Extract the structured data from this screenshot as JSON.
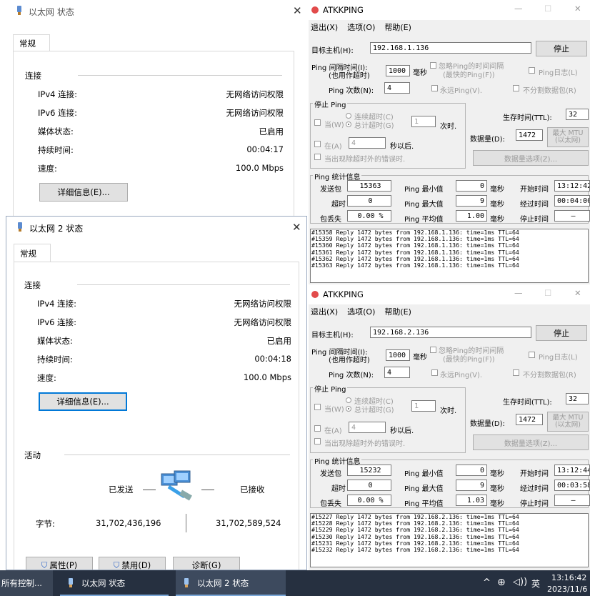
{
  "status1": {
    "title": "以太网 状态",
    "tab": "常规",
    "section": "连接",
    "rows": [
      {
        "label": "IPv4 连接:",
        "value": "无网络访问权限"
      },
      {
        "label": "IPv6 连接:",
        "value": "无网络访问权限"
      },
      {
        "label": "媒体状态:",
        "value": "已启用"
      },
      {
        "label": "持续时间:",
        "value": "00:04:17"
      },
      {
        "label": "速度:",
        "value": "100.0 Mbps"
      }
    ],
    "details_button": "详细信息(E)..."
  },
  "status2": {
    "title": "以太网 2 状态",
    "tab": "常规",
    "section": "连接",
    "rows": [
      {
        "label": "IPv4 连接:",
        "value": "无网络访问权限"
      },
      {
        "label": "IPv6 连接:",
        "value": "无网络访问权限"
      },
      {
        "label": "媒体状态:",
        "value": "已启用"
      },
      {
        "label": "持续时间:",
        "value": "00:04:18"
      },
      {
        "label": "速度:",
        "value": "100.0 Mbps"
      }
    ],
    "details_button": "详细信息(E)...",
    "activity": "活动",
    "sent_label": "已发送",
    "recv_label": "已接收",
    "bytes_label": "字节:",
    "bytes_sent": "31,702,436,196",
    "bytes_recv": "31,702,589,524",
    "buttons": [
      "属性(P)",
      "禁用(D)",
      "诊断(G)"
    ]
  },
  "atk_common": {
    "title": "ATKKPING",
    "menu": [
      "退出(X)",
      "选项(O)",
      "帮助(E)"
    ],
    "target_label": "目标主机(H):",
    "stop_button": "停止",
    "interval_label1": "Ping 间隔时间(I):",
    "interval_label2": "(也用作超时)",
    "interval_value": "1000",
    "ms_label": "毫秒",
    "ignore1": "忽略Ping的时间间隔",
    "ignore2": "(最快的Ping(F))",
    "pinglog": "Ping日志(L)",
    "count_label": "Ping 次数(N):",
    "count_value": "4",
    "forever": "永远Ping(V).",
    "nofrag": "不分割数据包(R)",
    "stop_group": "停止 Ping",
    "when": "当(W)",
    "consec": "连续超时(C)",
    "total": "总计超时(G)",
    "timeout_value": "1",
    "times": "次时.",
    "ttl_label": "生存时间(TTL):",
    "ttl_value": "32",
    "at_label": "在(A)",
    "at_value": "4",
    "sec_after": "秒以后.",
    "data_label": "数据量(D):",
    "data_value": "1472",
    "mtu1": "最大 MTU",
    "mtu2": "(以太网)",
    "on_error": "当出现除超时外的错误时.",
    "data_opts": "数据量选项(Z)...",
    "stats_group": "Ping 统计信息",
    "sent_label": "发送包",
    "timeout_label": "超时",
    "loss_label": "包丢失",
    "min_label": "Ping 最小值",
    "max_label": "Ping 最大值",
    "avg_label": "Ping 平均值",
    "start_label": "开始时间",
    "elapsed_label": "经过时间",
    "stop_label": "停止时间",
    "stop_time": "—"
  },
  "atk1": {
    "target": "192.168.1.136",
    "sent": "15363",
    "timeout": "0",
    "loss": "0.00 %",
    "min": "0",
    "max": "9",
    "avg": "1.00",
    "start": "13:12:42",
    "elapsed": "00:04:00",
    "log": [
      "#15358 Reply 1472 bytes from 192.168.1.136: time=1ms TTL=64",
      "#15359 Reply 1472 bytes from 192.168.1.136: time=1ms TTL=64",
      "#15360 Reply 1472 bytes from 192.168.1.136: time=1ms TTL=64",
      "#15361 Reply 1472 bytes from 192.168.1.136: time=1ms TTL=64",
      "#15362 Reply 1472 bytes from 192.168.1.136: time=1ms TTL=64",
      "#15363 Reply 1472 bytes from 192.168.1.136: time=1ms TTL=64"
    ]
  },
  "atk2": {
    "target": "192.168.2.136",
    "sent": "15232",
    "timeout": "0",
    "loss": "0.00 %",
    "min": "0",
    "max": "9",
    "avg": "1.03",
    "start": "13:12:44",
    "elapsed": "00:03:58",
    "log": [
      "#15227 Reply 1472 bytes from 192.168.2.136: time=1ms TTL=64",
      "#15228 Reply 1472 bytes from 192.168.2.136: time=1ms TTL=64",
      "#15229 Reply 1472 bytes from 192.168.2.136: time=1ms TTL=64",
      "#15230 Reply 1472 bytes from 192.168.2.136: time=1ms TTL=64",
      "#15231 Reply 1472 bytes from 192.168.2.136: time=1ms TTL=64",
      "#15232 Reply 1472 bytes from 192.168.2.136: time=1ms TTL=64"
    ]
  },
  "taskbar": {
    "items": [
      "所有控制...",
      "以太网 状态",
      "以太网 2 状态"
    ],
    "lang": "英",
    "time": "13:16:42",
    "date": "2023/11/6"
  }
}
